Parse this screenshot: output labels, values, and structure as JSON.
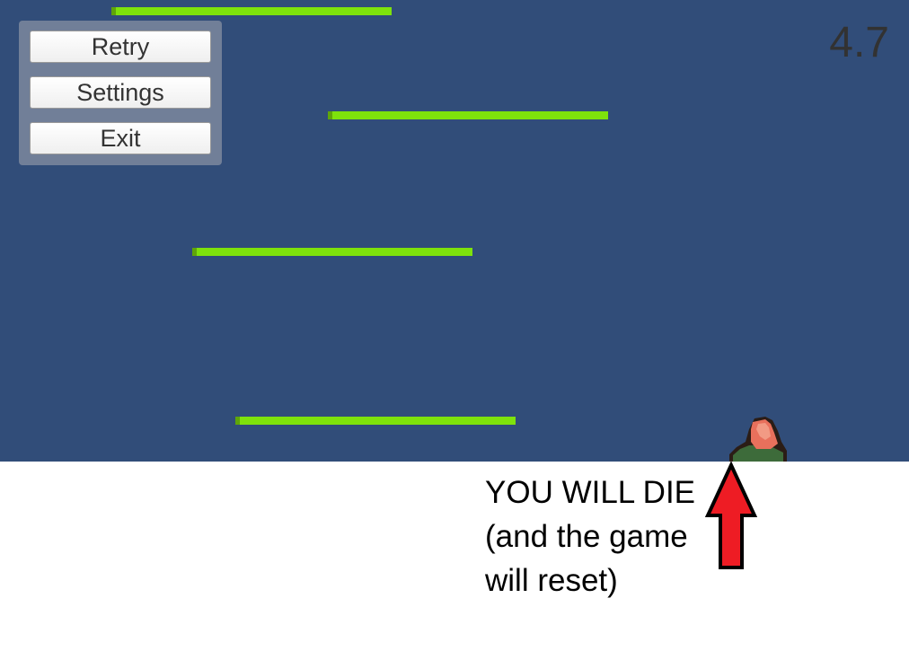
{
  "pause_menu": {
    "retry_label": "Retry",
    "settings_label": "Settings",
    "exit_label": "Exit"
  },
  "hud": {
    "timer": "4.7"
  },
  "annotation": {
    "lines": [
      "YOU WILL DIE",
      "(and the game",
      "will reset)"
    ]
  },
  "icons": {
    "player": "player-character-icon",
    "arrow": "up-arrow-icon"
  },
  "colors": {
    "sky": "#314d79",
    "platform": "#7ee20c",
    "menu_panel": "#717f98",
    "arrow": "#ee1c24"
  }
}
